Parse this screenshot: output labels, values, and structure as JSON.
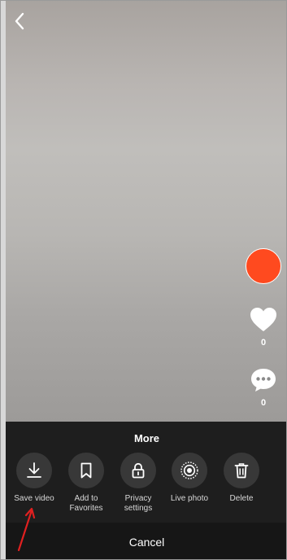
{
  "sidebar": {
    "like_count": "0",
    "comment_count": "0"
  },
  "sheet": {
    "title": "More",
    "options": [
      {
        "label": "Save video",
        "icon": "download-icon"
      },
      {
        "label": "Add to\nFavorites",
        "icon": "bookmark-icon"
      },
      {
        "label": "Privacy\nsettings",
        "icon": "lock-icon"
      },
      {
        "label": "Live photo",
        "icon": "live-photo-icon"
      },
      {
        "label": "Delete",
        "icon": "trash-icon"
      }
    ],
    "cancel_label": "Cancel"
  },
  "colors": {
    "avatar": "#ff4a1f",
    "sheet_bg": "#1e1e1e",
    "option_circle": "#383838",
    "annotation_arrow": "#e02020"
  }
}
